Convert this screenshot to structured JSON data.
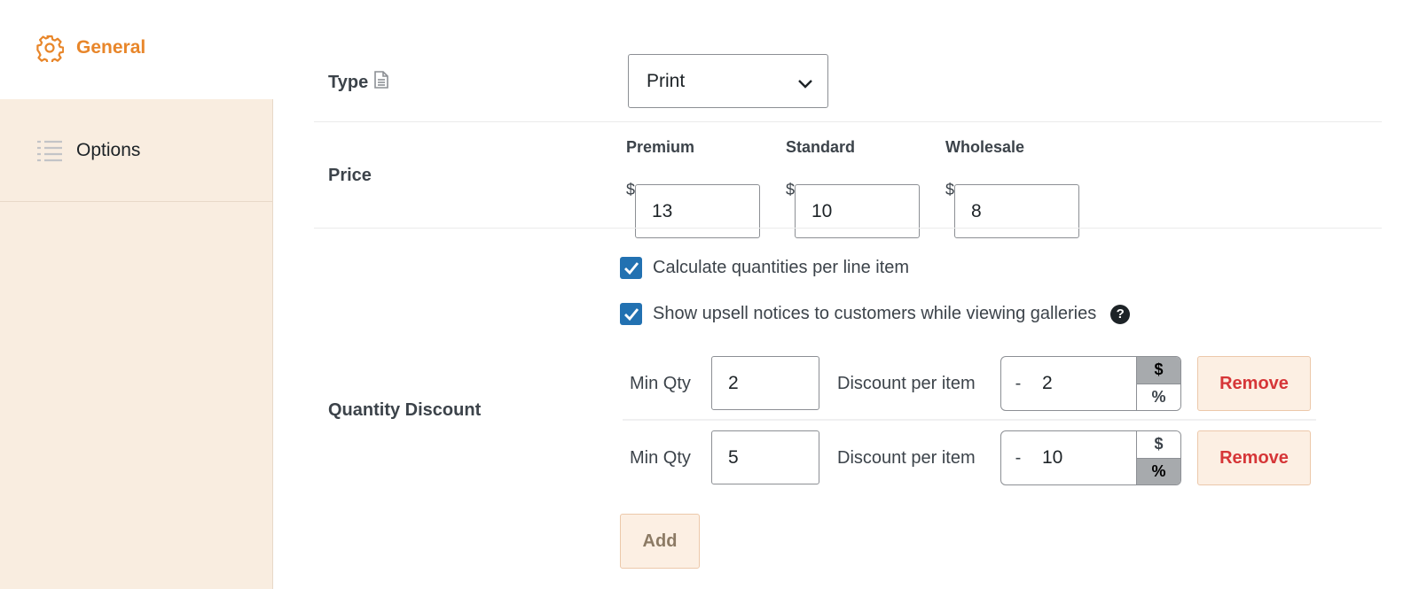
{
  "sidebar": {
    "items": [
      {
        "label": "General",
        "icon": "gear-icon",
        "active": true
      },
      {
        "label": "Options",
        "icon": "list-icon",
        "active": false
      }
    ]
  },
  "type_row": {
    "label": "Type",
    "icon": "document-icon",
    "selected": "Print"
  },
  "price_row": {
    "label": "Price",
    "currency": "$",
    "tiers": [
      {
        "name": "Premium",
        "value": "13"
      },
      {
        "name": "Standard",
        "value": "10"
      },
      {
        "name": "Wholesale",
        "value": "8"
      }
    ]
  },
  "quantity_discount": {
    "label": "Quantity Discount",
    "checkboxes": [
      {
        "label": "Calculate quantities per line item",
        "checked": true
      },
      {
        "label": "Show upsell notices to customers while viewing galleries",
        "checked": true,
        "help": "?"
      }
    ],
    "rows": [
      {
        "min_label": "Min Qty",
        "min_value": "2",
        "disc_label": "Discount per item",
        "minus": "-",
        "disc_value": "2",
        "unit_dollar": "$",
        "unit_percent": "%",
        "selected_unit": "$",
        "remove_label": "Remove"
      },
      {
        "min_label": "Min Qty",
        "min_value": "5",
        "disc_label": "Discount per item",
        "minus": "-",
        "disc_value": "10",
        "unit_dollar": "$",
        "unit_percent": "%",
        "selected_unit": "%",
        "remove_label": "Remove"
      }
    ],
    "add_label": "Add"
  },
  "colors": {
    "accent": "#e8862a",
    "checkbox": "#2271b1",
    "remove": "#d63638",
    "sidebar_bg": "#f9ede0"
  }
}
